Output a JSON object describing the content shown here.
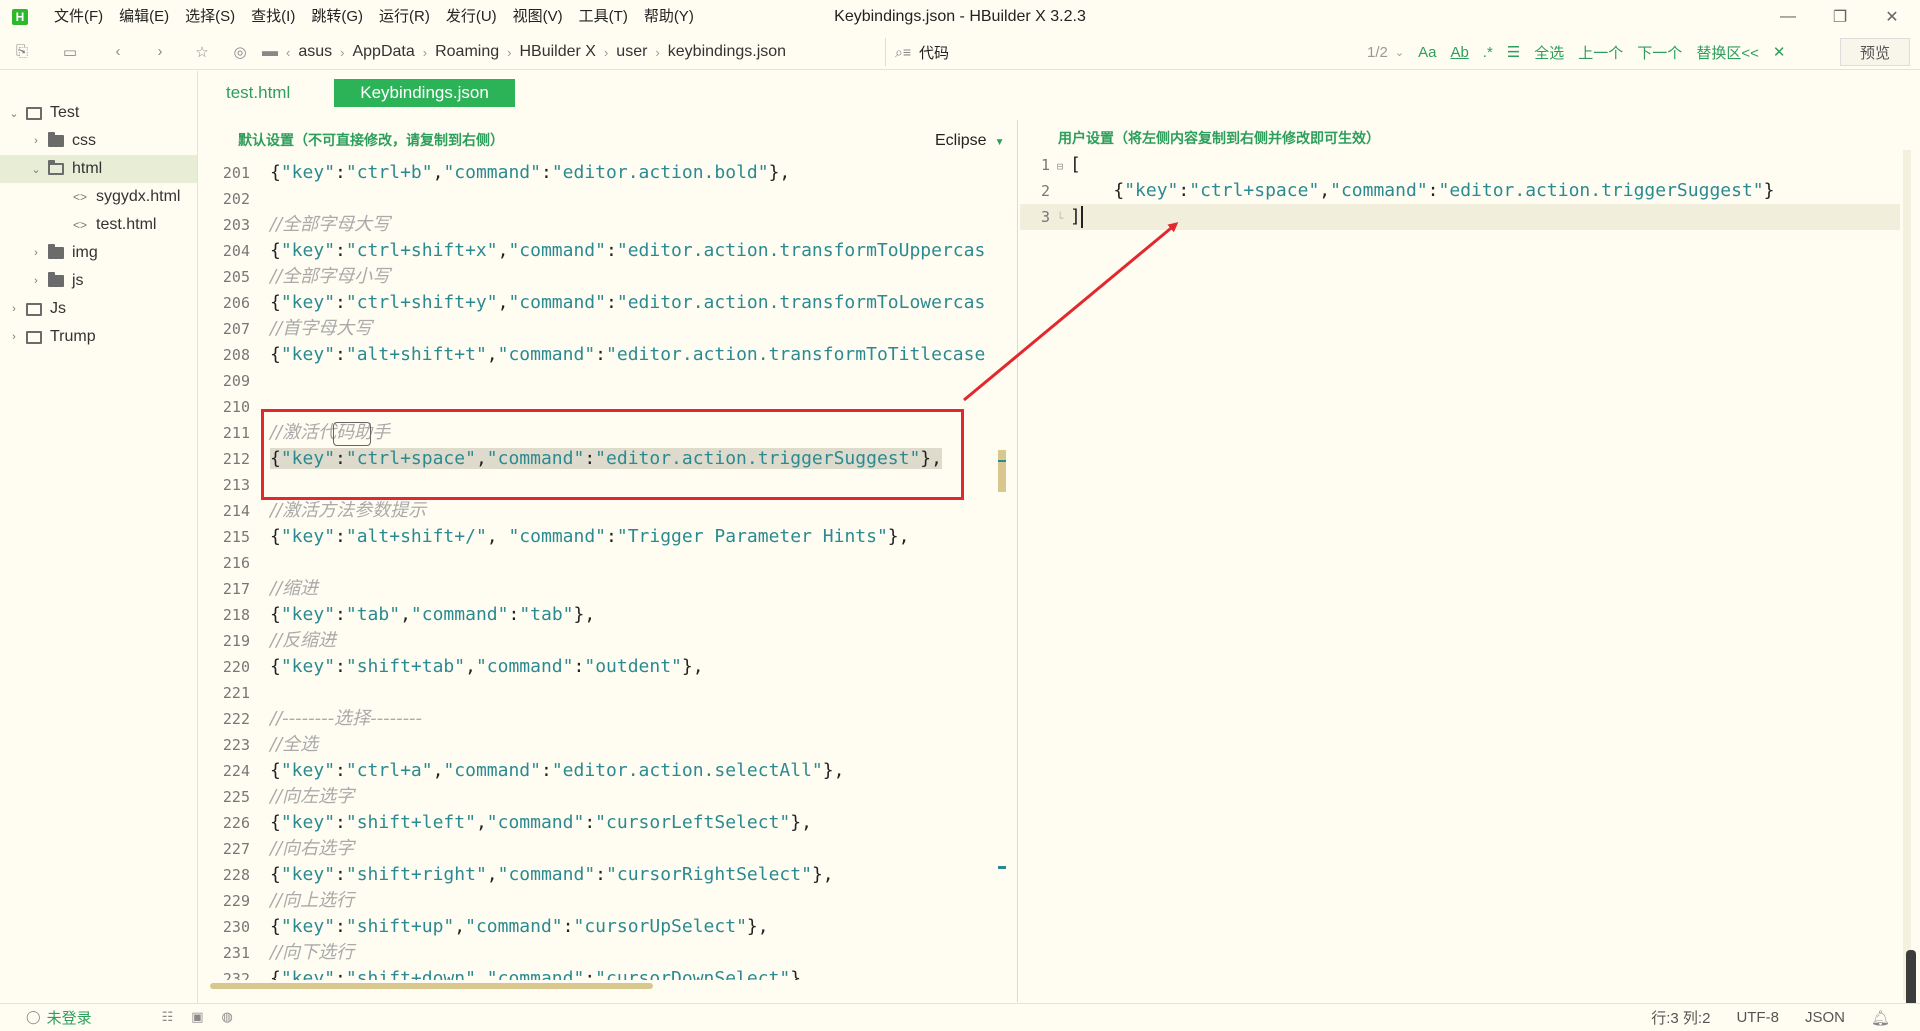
{
  "app": {
    "logo": "H",
    "window_title": "Keybindings.json - HBuilder X 3.2.3"
  },
  "menu": [
    "文件(F)",
    "编辑(E)",
    "选择(S)",
    "查找(I)",
    "跳转(G)",
    "运行(R)",
    "发行(U)",
    "视图(V)",
    "工具(T)",
    "帮助(Y)"
  ],
  "breadcrumb": [
    "asus",
    "AppData",
    "Roaming",
    "HBuilder X",
    "user",
    "keybindings.json"
  ],
  "search": {
    "value": "代码",
    "count": "1/2",
    "select_all": "全选",
    "prev": "上一个",
    "next": "下一个",
    "replace": "替换区<<",
    "preview": "预览"
  },
  "sidebar": {
    "items": [
      {
        "label": "Test",
        "level": 0,
        "kind": "project",
        "expanded": true
      },
      {
        "label": "css",
        "level": 1,
        "kind": "folder",
        "expanded": false
      },
      {
        "label": "html",
        "level": 1,
        "kind": "folder",
        "expanded": true,
        "selected": true
      },
      {
        "label": "sygydx.html",
        "level": 2,
        "kind": "file"
      },
      {
        "label": "test.html",
        "level": 2,
        "kind": "file"
      },
      {
        "label": "img",
        "level": 1,
        "kind": "folder",
        "expanded": false
      },
      {
        "label": "js",
        "level": 1,
        "kind": "folder",
        "expanded": false
      },
      {
        "label": "Js",
        "level": 0,
        "kind": "project",
        "expanded": false
      },
      {
        "label": "Trump",
        "level": 0,
        "kind": "project",
        "expanded": false
      }
    ]
  },
  "tabs": [
    {
      "label": "test.html",
      "active": false
    },
    {
      "label": "Keybindings.json",
      "active": true
    }
  ],
  "left_pane": {
    "header": "默认设置（不可直接修改，请复制到右侧）",
    "keymap": "Eclipse",
    "lines": [
      {
        "n": "201",
        "type": "code",
        "key": "ctrl+b",
        "cmd": "editor.action.bold",
        "tail": "},"
      },
      {
        "n": "202",
        "type": "blank"
      },
      {
        "n": "203",
        "type": "comment",
        "text": "//全部字母大写"
      },
      {
        "n": "204",
        "type": "code",
        "key": "ctrl+shift+x",
        "cmd": "editor.action.transformToUppercas",
        "tail": "",
        "open_end": true
      },
      {
        "n": "205",
        "type": "comment",
        "text": "//全部字母小写"
      },
      {
        "n": "206",
        "type": "code",
        "key": "ctrl+shift+y",
        "cmd": "editor.action.transformToLowercas",
        "tail": "",
        "open_end": true
      },
      {
        "n": "207",
        "type": "comment",
        "text": "//首字母大写"
      },
      {
        "n": "208",
        "type": "code",
        "key": "alt+shift+t",
        "cmd": "editor.action.transformToTitlecase",
        "tail": "",
        "open_end": true
      },
      {
        "n": "209",
        "type": "blank"
      },
      {
        "n": "210",
        "type": "blank"
      },
      {
        "n": "211",
        "type": "comment",
        "text": "//激活代码助手"
      },
      {
        "n": "212",
        "type": "code",
        "key": "ctrl+space",
        "cmd": "editor.action.triggerSuggest",
        "tail": "},",
        "selected": true
      },
      {
        "n": "213",
        "type": "blank"
      },
      {
        "n": "214",
        "type": "comment",
        "text": "//激活方法参数提示"
      },
      {
        "n": "215",
        "type": "code",
        "key": "alt+shift+/",
        "cmd": "Trigger Parameter Hints",
        "tail": "},",
        "space_cmd": true
      },
      {
        "n": "216",
        "type": "blank"
      },
      {
        "n": "217",
        "type": "comment",
        "text": "//缩进"
      },
      {
        "n": "218",
        "type": "code",
        "key": "tab",
        "cmd": "tab",
        "tail": "},"
      },
      {
        "n": "219",
        "type": "comment",
        "text": "//反缩进"
      },
      {
        "n": "220",
        "type": "code",
        "key": "shift+tab",
        "cmd": "outdent",
        "tail": "},"
      },
      {
        "n": "221",
        "type": "blank"
      },
      {
        "n": "222",
        "type": "comment",
        "text": "//--------选择--------"
      },
      {
        "n": "223",
        "type": "comment",
        "text": "//全选"
      },
      {
        "n": "224",
        "type": "code",
        "key": "ctrl+a",
        "cmd": "editor.action.selectAll",
        "tail": "},"
      },
      {
        "n": "225",
        "type": "comment",
        "text": "//向左选字"
      },
      {
        "n": "226",
        "type": "code",
        "key": "shift+left",
        "cmd": "cursorLeftSelect",
        "tail": "},"
      },
      {
        "n": "227",
        "type": "comment",
        "text": "//向右选字"
      },
      {
        "n": "228",
        "type": "code",
        "key": "shift+right",
        "cmd": "cursorRightSelect",
        "tail": "},"
      },
      {
        "n": "229",
        "type": "comment",
        "text": "//向上选行"
      },
      {
        "n": "230",
        "type": "code",
        "key": "shift+up",
        "cmd": "cursorUpSelect",
        "tail": "},"
      },
      {
        "n": "231",
        "type": "comment",
        "text": "//向下选行"
      },
      {
        "n": "232",
        "type": "code",
        "key": "shift+down",
        "cmd": "cursorDownSelect",
        "tail": "},"
      }
    ]
  },
  "right_pane": {
    "header": "用户设置（将左侧内容复制到右侧并修改即可生效）",
    "line1": "[",
    "line2_key": "ctrl+space",
    "line2_cmd": "editor.action.triggerSuggest",
    "line3": "]",
    "line_numbers": [
      "1",
      "2",
      "3"
    ]
  },
  "status": {
    "login": "未登录",
    "position": "行:3  列:2",
    "encoding": "UTF-8",
    "language": "JSON"
  },
  "colors": {
    "accent_green": "#2cb358",
    "annotation_red": "#e0282e",
    "key_teal": "#2b8a91"
  }
}
